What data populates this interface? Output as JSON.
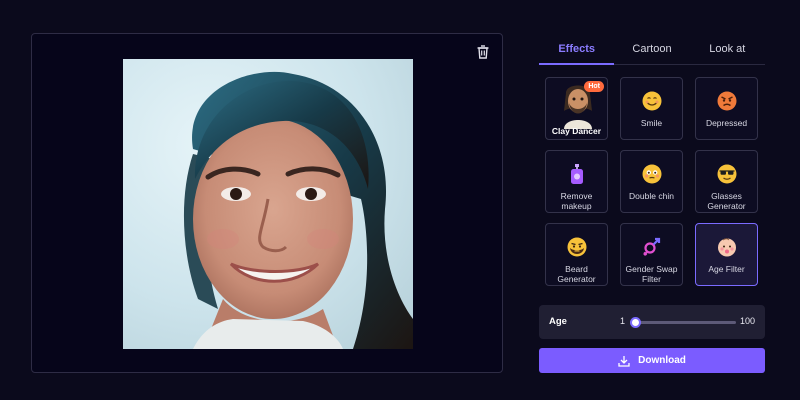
{
  "tabs": [
    {
      "label": "Effects",
      "active": true
    },
    {
      "label": "Cartoon",
      "active": false
    },
    {
      "label": "Look at",
      "active": false
    }
  ],
  "effects": [
    {
      "label": "Clay Dancer",
      "icon": "clay-figure-icon",
      "badge": "Hot"
    },
    {
      "label": "Smile",
      "icon": "smiling-face-icon"
    },
    {
      "label": "Depressed",
      "icon": "angry-face-icon"
    },
    {
      "label_lines": [
        "Remove",
        "makeup"
      ],
      "icon": "makeup-remover-icon"
    },
    {
      "label": "Double chin",
      "icon": "flushed-face-icon"
    },
    {
      "label_lines": [
        "Glasses",
        "Generator"
      ],
      "icon": "sunglasses-face-icon"
    },
    {
      "label_lines": [
        "Beard",
        "Generator"
      ],
      "icon": "beard-face-icon"
    },
    {
      "label_lines": [
        "Gender Swap",
        "Filter"
      ],
      "icon": "gender-symbol-icon"
    },
    {
      "label": "Age Filter",
      "icon": "baby-face-icon",
      "selected": true
    }
  ],
  "age": {
    "label": "Age",
    "min": "1",
    "max": "100",
    "value": 3
  },
  "download": {
    "label": "Download"
  },
  "colors": {
    "accent": "#7b6bff",
    "background": "#0b0a1c",
    "button": "#7b5cff"
  }
}
